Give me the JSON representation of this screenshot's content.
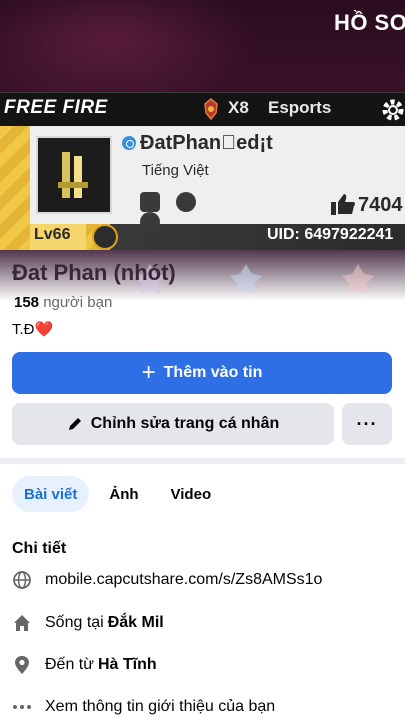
{
  "cover": {
    "corner_title": "HỒ SƠ",
    "game_logo": "FREE FIRE",
    "rank_count": "X8",
    "esports_label": "Esports",
    "player_name": "ĐatPhan\u0000ed¡t",
    "language": "Tiếng Việt",
    "likes": "7404",
    "level": "Lv66",
    "uid": "UID: 6497922241",
    "accent_color": "#f0c844"
  },
  "profile": {
    "name": "Đat Phan (nhót)",
    "friends_count": "158",
    "friends_label": "người bạn",
    "bio": "T.Đ❤️"
  },
  "actions": {
    "add_story_label": "Thêm vào tin",
    "edit_profile_label": "Chỉnh sửa trang cá nhân",
    "more_label": "···",
    "primary_color": "#2f6fe6"
  },
  "tabs": [
    {
      "label": "Bài viết",
      "active": true
    },
    {
      "label": "Ảnh",
      "active": false
    },
    {
      "label": "Video",
      "active": false
    }
  ],
  "details": {
    "title": "Chi tiết",
    "items": [
      {
        "icon": "globe-icon",
        "text": "mobile.capcutshare.com/s/Zs8AMSs1o",
        "strong": ""
      },
      {
        "icon": "home-icon",
        "text": "Sống tại",
        "strong": "Đắk Mil"
      },
      {
        "icon": "location-pin-icon",
        "text": "Đến từ",
        "strong": "Hà Tĩnh"
      },
      {
        "icon": "more-dots-icon",
        "text": "Xem thông tin giới thiệu của bạn",
        "strong": ""
      }
    ]
  }
}
